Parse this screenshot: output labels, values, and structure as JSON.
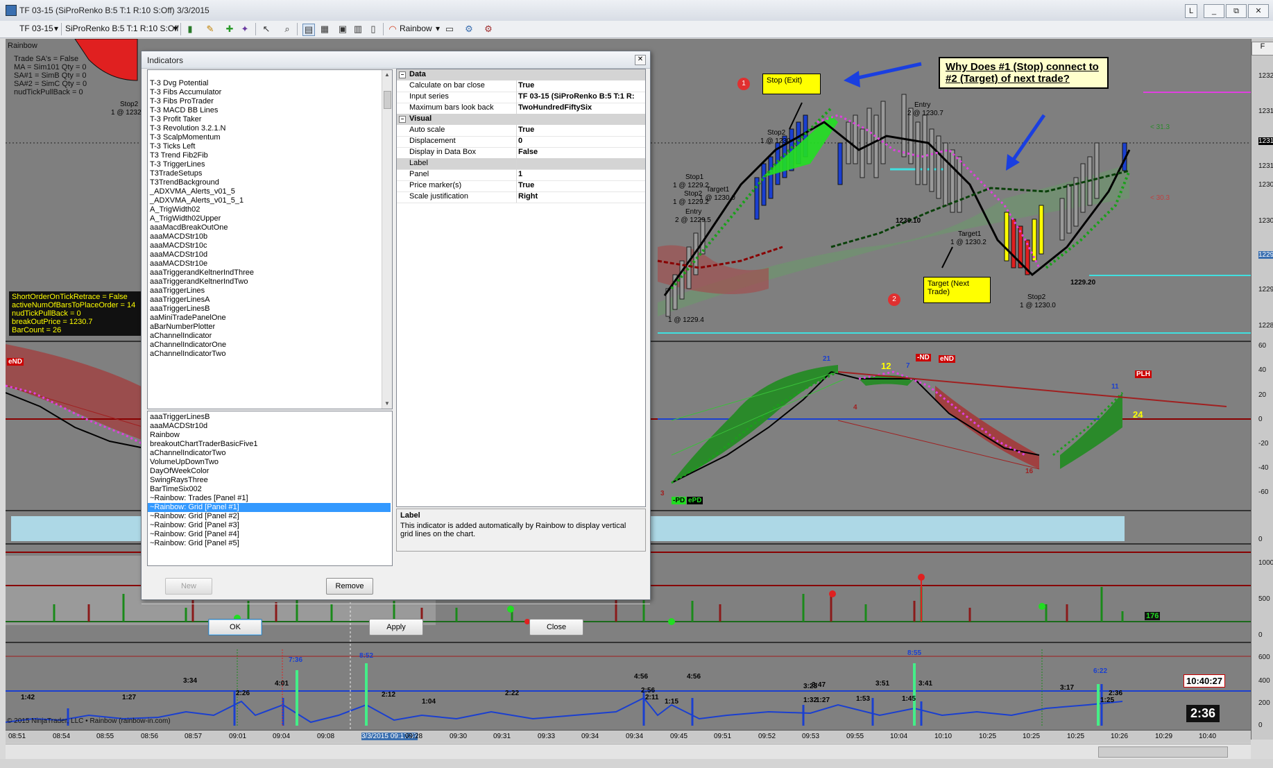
{
  "window": {
    "title": "TF 03-15 (SiProRenko B:5 T:1 R:10 S:Off)  3/3/2015",
    "buttons": [
      "L",
      "_",
      "⧉",
      "✕"
    ]
  },
  "toolbar": {
    "instrument": "TF 03-15",
    "bar_type": "SiProRenko B:5 T:1 R:10 S:Off",
    "strategy": "Rainbow"
  },
  "chart": {
    "panel_label": "Rainbow",
    "top_info": [
      "Trade SA's = False",
      "MA = Sim101      Qty = 0",
      "SA#1 = SimB      Qty = 0",
      "SA#2 = SimC      Qty = 0",
      "nudTickPullBack = 0"
    ],
    "params_box": [
      "ShortOrderOnTickRetrace = False",
      "activeNumOfBarsToPlaceOrder = 14",
      "nudTickPullBack = 0",
      "breakOutPrice = 1230.7",
      " BarCount = 26"
    ],
    "question": "Why Does #1 (Stop) connect to #2 (Target) of next trade?",
    "stop_exit": "Stop (Exit)",
    "target_next": "Target (Next Trade)",
    "circle1": "1",
    "circle2": "2",
    "trade_labels": [
      "Stop2",
      "1 @ 1230",
      "Stop1",
      "1 @ 1229.2",
      "Stop2",
      "1 @ 1229.2",
      "Target1",
      "1 @ 1230.0",
      "Entry",
      "2 @ 1229.5",
      "Entry",
      "2 @ 1230.7",
      "Target1",
      "1 @ 1230.2",
      "Stop2",
      "1 @ 1230.0",
      "1230.10",
      "1229.20",
      "Stop2",
      "1 @ 1232",
      "1 @ 1229.4",
      "< 31.3",
      "< 30.3"
    ],
    "price_axis": [
      "1232.0",
      "1231.5",
      "1231.1",
      "1231.0",
      "1230.5",
      "1230.0",
      "1229.5",
      "1229.0",
      "1228.5"
    ],
    "osc_axis": [
      "60",
      "40",
      "20",
      "0",
      "-20",
      "-40",
      "-60"
    ],
    "osc_labels": [
      "eND",
      "21",
      "12",
      "7",
      "-ND",
      "eND",
      "PLH",
      "11",
      "24",
      "4",
      "3",
      "16",
      "-PD",
      "ePD"
    ],
    "vol_axis": [
      "0",
      "1000",
      "500",
      "0"
    ],
    "vol_badge": "176",
    "time_axis_y": [
      "600",
      "400",
      "200",
      "0"
    ],
    "time_labels": [
      "1:42",
      "1:27",
      "3:34",
      "2:26",
      "4:01",
      "7:36",
      "8:52",
      "2:12",
      "1:04",
      "2:22",
      "4:56",
      "2:56",
      "2:11",
      "1:15",
      "4:56",
      "1:32",
      "1:27",
      "3:23",
      "3:47",
      "1:53",
      "3:51",
      "8:55",
      "1:45",
      "3:41",
      "3:17",
      "6:22",
      "1:25",
      "2:36"
    ],
    "clock": "10:40:27",
    "timer": "2:36",
    "copyright": "© 2015 NinjaTrader, LLC • Rainbow (rainbow-in.com)",
    "x_axis": [
      "08:51",
      "08:54",
      "08:55",
      "08:56",
      "08:57",
      "09:01",
      "09:04",
      "09:08",
      "3/3/2015 09:17:37",
      "09:28",
      "09:30",
      "09:31",
      "09:33",
      "09:34",
      "09:34",
      "09:45",
      "09:51",
      "09:52",
      "09:53",
      "09:55",
      "10:04",
      "10:10",
      "10:25",
      "10:25",
      "10:25",
      "10:26",
      "10:29",
      "10:40"
    ]
  },
  "dialog": {
    "title": "Indicators",
    "available": [
      "T-3 Dvg Potential",
      "T-3 Fibs Accumulator",
      "T-3 Fibs ProTrader",
      "T-3 MACD BB Lines",
      "T-3 Profit Taker",
      "T-3 Revolution 3.2.1.N",
      "T-3 ScalpMomentum",
      "T-3 Ticks Left",
      "T3 Trend Fib2Fib",
      "T-3 TriggerLines",
      "T3TradeSetups",
      "T3TrendBackground",
      "_ADXVMA_Alerts_v01_5",
      "_ADXVMA_Alerts_v01_5_1",
      "A_TrigWidth02",
      "A_TrigWidth02Upper",
      "aaaMacdBreakOutOne",
      "aaaMACDStr10b",
      "aaaMACDStr10c",
      "aaaMACDStr10d",
      "aaaMACDStr10e",
      "aaaTriggerandKeltnerIndThree",
      "aaaTriggerandKeltnerIndTwo",
      "aaaTriggerLines",
      "aaaTriggerLinesA",
      "aaaTriggerLinesB",
      "aaMiniTradePanelOne",
      "aBarNumberPlotter",
      "aChannelIndicator",
      "aChannelIndicatorOne",
      "aChannelIndicatorTwo"
    ],
    "applied": [
      "aaaTriggerLinesB",
      "aaaMACDStr10d",
      "Rainbow",
      "breakoutChartTraderBasicFive1",
      "aChannelIndicatorTwo",
      "VolumeUpDownTwo",
      "DayOfWeekColor",
      "SwingRaysThree",
      "BarTimeSix002",
      "~Rainbow: Trades [Panel #1]",
      "~Rainbow: Grid [Panel #1]",
      "~Rainbow: Grid [Panel #2]",
      "~Rainbow: Grid [Panel #3]",
      "~Rainbow: Grid [Panel #4]",
      "~Rainbow: Grid [Panel #5]"
    ],
    "selected_index": 10,
    "new_label": "New",
    "remove_label": "Remove",
    "ok_label": "OK",
    "apply_label": "Apply",
    "close_label": "Close",
    "properties": {
      "data_cat": "Data",
      "visual_cat": "Visual",
      "data_rows": [
        {
          "name": "Calculate on bar close",
          "value": "True"
        },
        {
          "name": "Input series",
          "value": "TF 03-15 (SiProRenko B:5 T:1 R:"
        },
        {
          "name": "Maximum bars look back",
          "value": "TwoHundredFiftySix"
        }
      ],
      "visual_rows": [
        {
          "name": "Auto scale",
          "value": "True"
        },
        {
          "name": "Displacement",
          "value": "0"
        },
        {
          "name": "Display in Data Box",
          "value": "False"
        },
        {
          "name": "Label",
          "value": ""
        },
        {
          "name": "Panel",
          "value": "1"
        },
        {
          "name": "Price marker(s)",
          "value": "True"
        },
        {
          "name": "Scale justification",
          "value": "Right"
        }
      ]
    },
    "desc_title": "Label",
    "desc_text": "This indicator is added automatically by Rainbow to display vertical grid lines on the chart."
  }
}
